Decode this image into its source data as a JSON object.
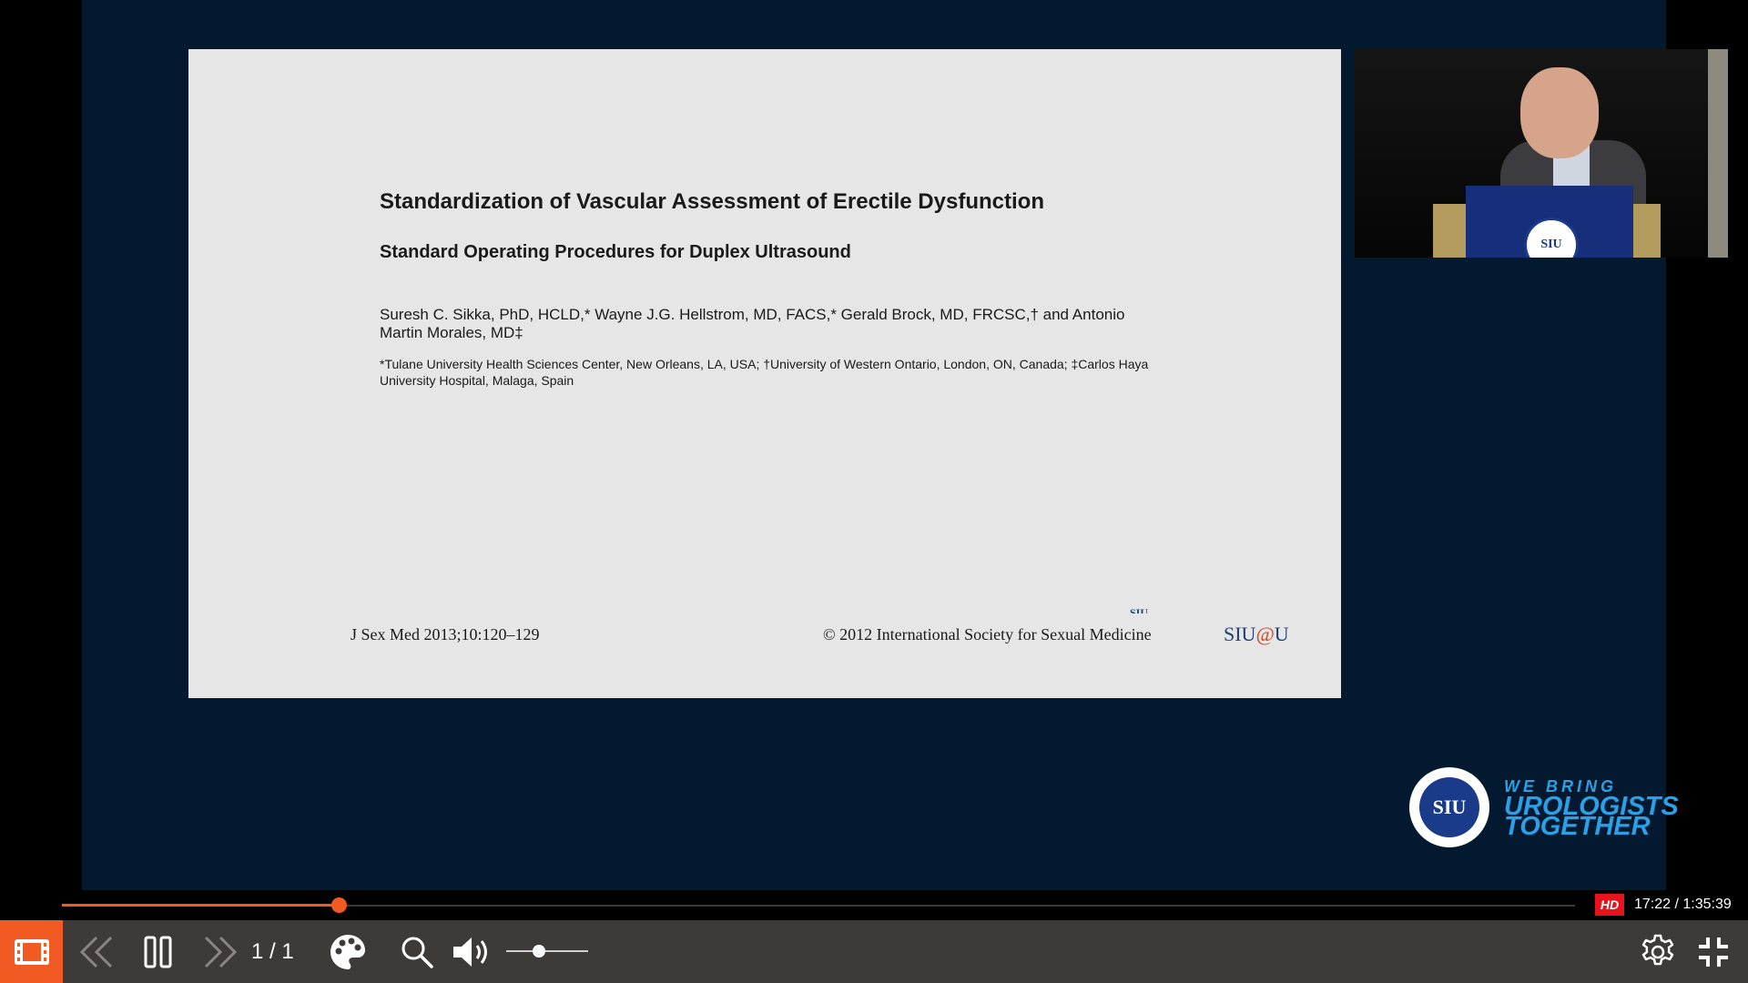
{
  "slide": {
    "title": "Standardization of Vascular Assessment of Erectile Dysfunction",
    "subtitle": "Standard Operating Procedures for Duplex Ultrasound",
    "authors": "Suresh C. Sikka, PhD, HCLD,* Wayne J.G. Hellstrom, MD, FACS,* Gerald Brock, MD, FRCSC,† and Antonio Martin Morales, MD‡",
    "affiliations": "*Tulane University Health Sciences Center, New Orleans, LA, USA; †University of Western Ontario, London, ON, Canada; ‡Carlos Haya University Hospital, Malaga, Spain",
    "journal": "J Sex Med 2013;10:120–129",
    "copyright": "© 2012 International Society for Sexual Medicine",
    "siu_top": "SIU",
    "logo_prefix": "SIU",
    "logo_at": "@",
    "logo_suffix": "U"
  },
  "speaker_video": {
    "lectern_seal": "SIU"
  },
  "branding": {
    "seal_text": "SIU",
    "tagline_1": "WE BRING",
    "tagline_2": "UROLOGISTS",
    "tagline_3": "TOGETHER",
    "color": "#2aa0e6"
  },
  "player": {
    "progress_fraction": 0.1829,
    "quality_badge": "HD",
    "time": "17:22 / 1:35:39",
    "page_count": "1 / 1",
    "volume_fraction": 0.4,
    "accent_color": "#f15a22",
    "icons": [
      "film-strip-icon",
      "rewind-icon",
      "pause-icon",
      "forward-icon",
      "palette-icon",
      "search-icon",
      "volume-icon",
      "settings-icon",
      "exit-fullscreen-icon"
    ]
  }
}
